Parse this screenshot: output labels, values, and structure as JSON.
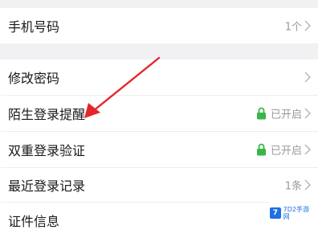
{
  "rows": [
    {
      "label": "手机号码",
      "value": "1个"
    },
    {
      "label": "修改密码",
      "value": ""
    },
    {
      "label": "陌生登录提醒",
      "value": "已开启"
    },
    {
      "label": "双重登录验证",
      "value": "已开启"
    },
    {
      "label": "最近登录记录",
      "value": "1条"
    },
    {
      "label": "证件信息",
      "value": ""
    }
  ],
  "colors": {
    "annotation_arrow": "#e3262a",
    "lock": "#39b54a",
    "background": "#f1f1f3"
  },
  "icons": [
    "chevron-right-icon",
    "lock-icon"
  ],
  "watermark": {
    "text": "7D2手游网"
  }
}
